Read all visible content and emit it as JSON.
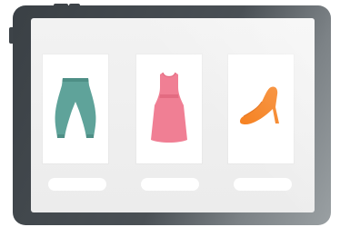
{
  "products": [
    {
      "name": "pants-icon",
      "color": "#5fa39a"
    },
    {
      "name": "dress-icon",
      "color": "#f07f94"
    },
    {
      "name": "high-heel-icon",
      "color": "#f57a14"
    }
  ],
  "colors": {
    "frame": "#3d4348",
    "screen": "#efefef",
    "card": "#ffffff"
  }
}
